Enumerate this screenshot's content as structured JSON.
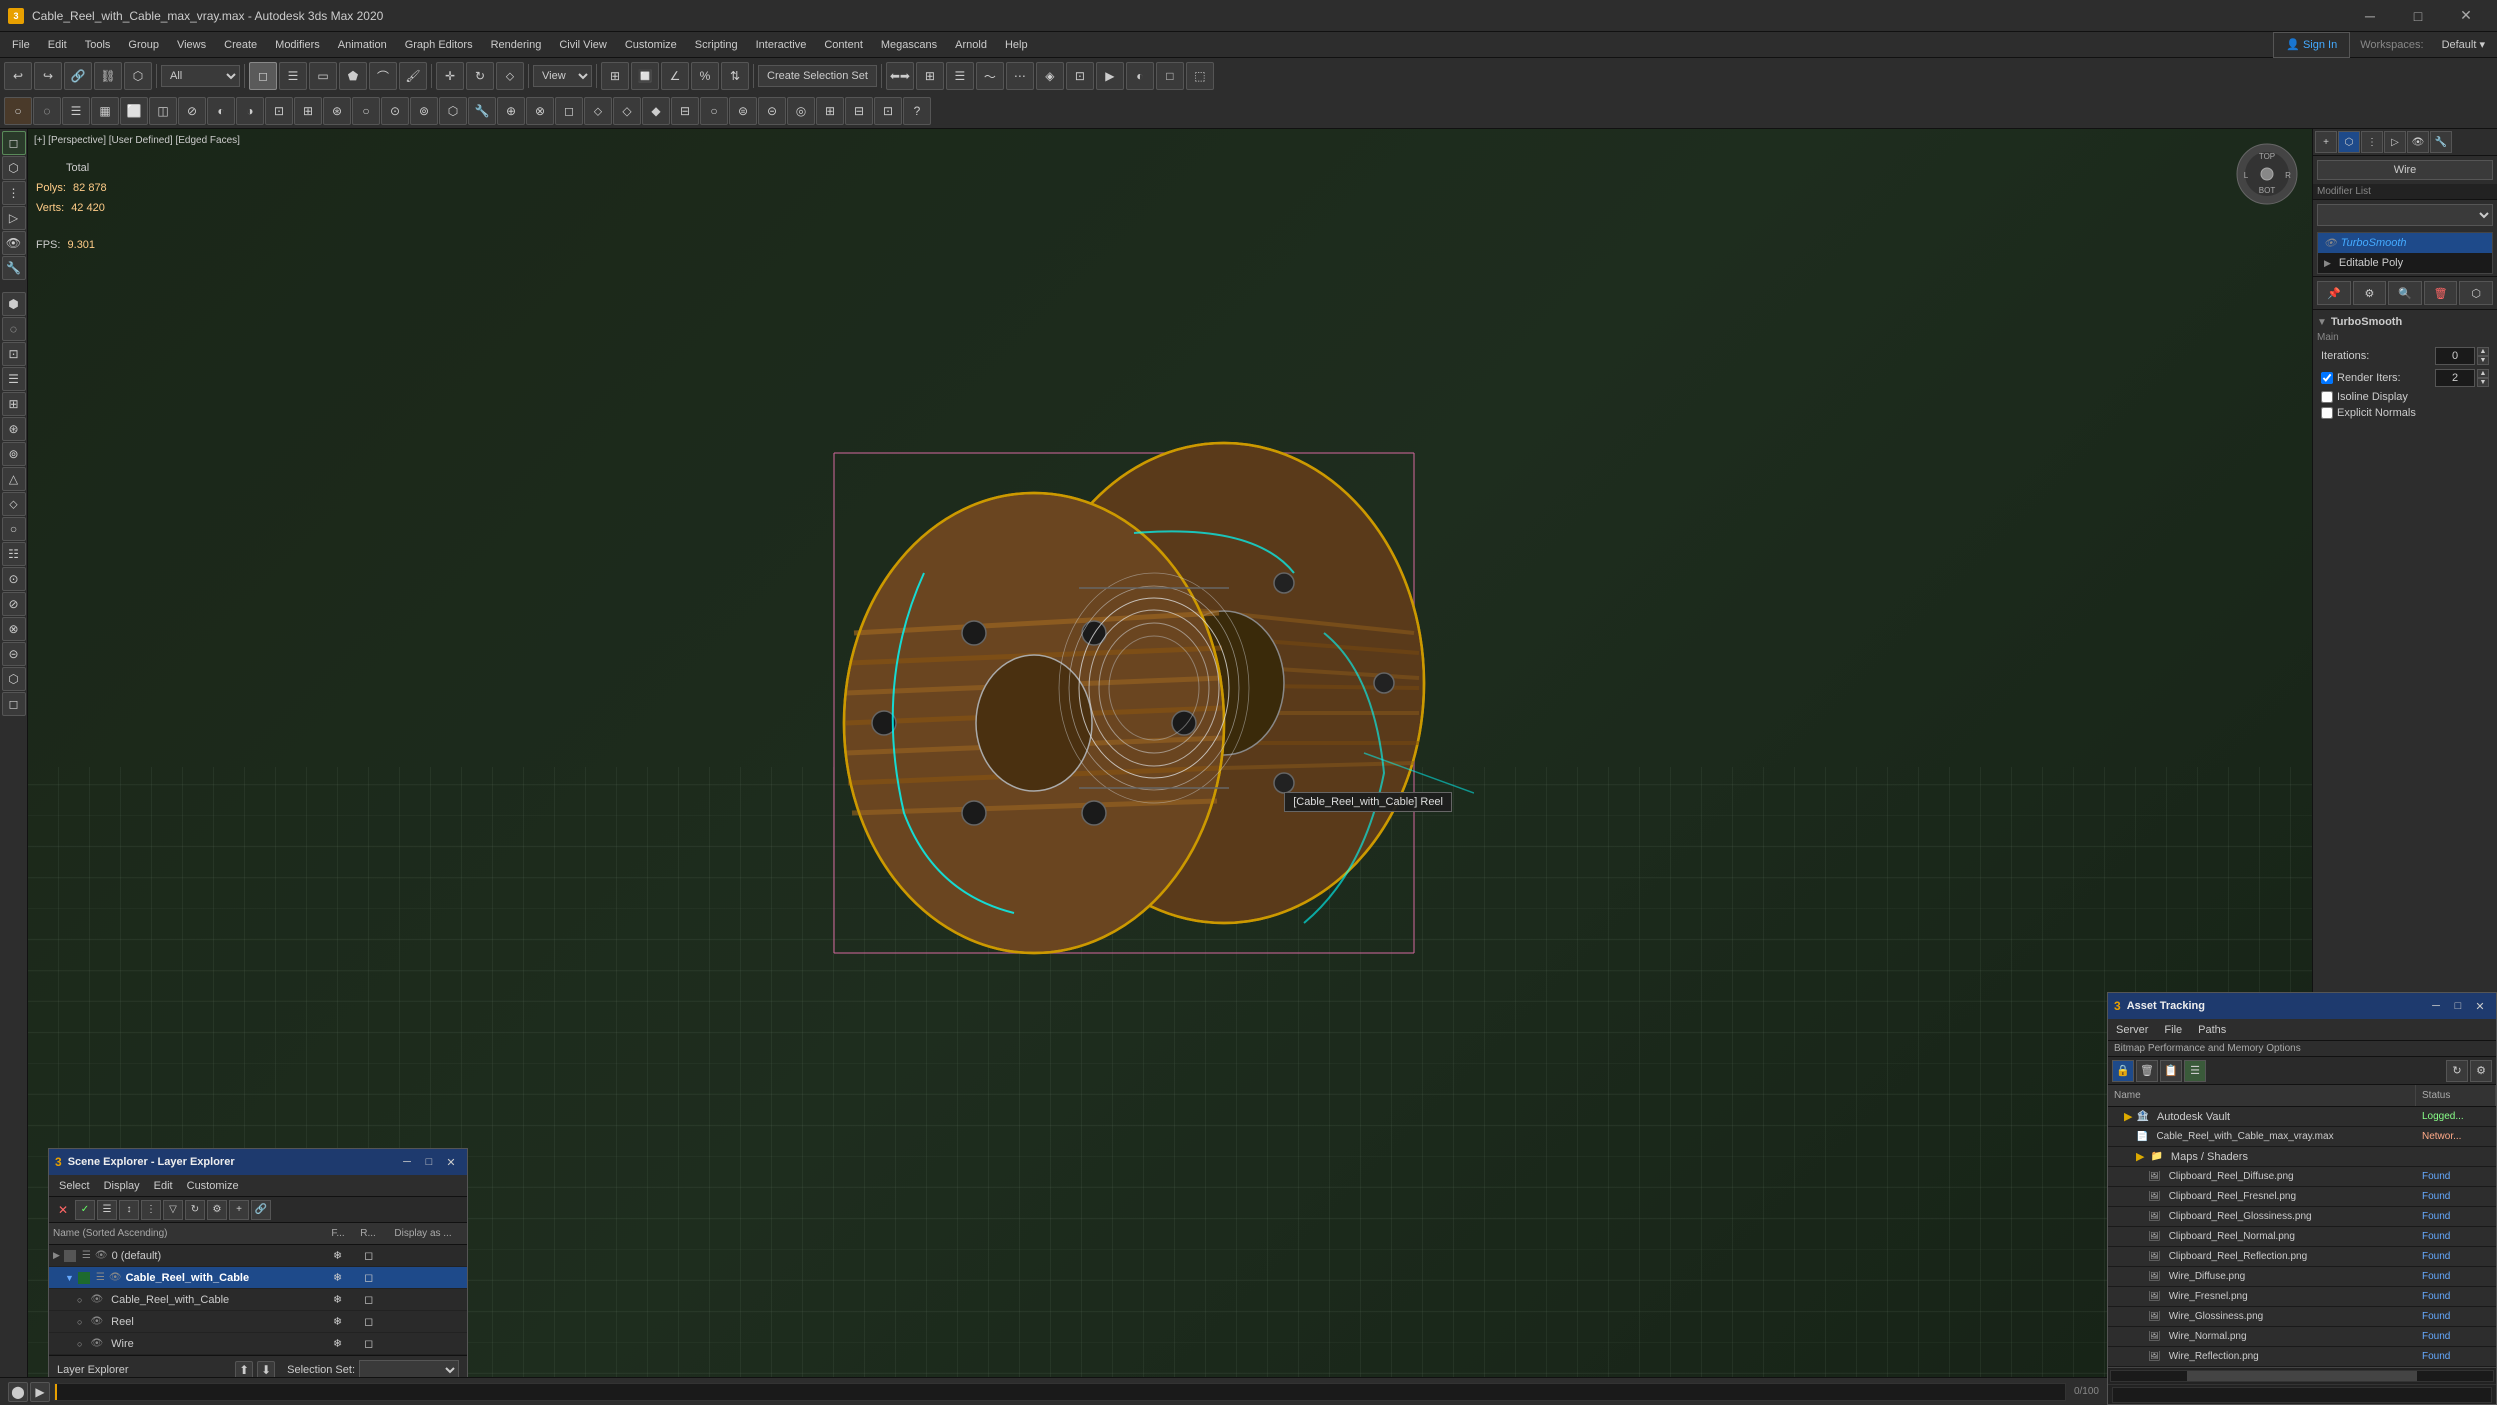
{
  "window": {
    "title": "Cable_Reel_with_Cable_max_vray.max - Autodesk 3ds Max 2020",
    "icon": "3"
  },
  "titlebar": {
    "title": "Cable_Reel_with_Cable_max_vray.max - Autodesk 3ds Max 2020",
    "minimize": "─",
    "maximize": "□",
    "close": "✕"
  },
  "menubar": {
    "items": [
      "File",
      "Edit",
      "Tools",
      "Group",
      "Views",
      "Create",
      "Modifiers",
      "Animation",
      "Graph Editors",
      "Rendering",
      "Civil View",
      "Customize",
      "Scripting",
      "Interactive",
      "Content",
      "Megascans",
      "Arnold",
      "Help"
    ]
  },
  "toolbar": {
    "mode_dropdown": "All",
    "create_selection_set": "Create Selection Set",
    "view_dropdown": "View"
  },
  "viewport": {
    "label": "[+] [Perspective] [User Defined] [Edged Faces]",
    "stats": {
      "total_label": "Total",
      "polys_label": "Polys:",
      "polys_value": "82 878",
      "verts_label": "Verts:",
      "verts_value": "42 420",
      "fps_label": "FPS:",
      "fps_value": "9.301"
    },
    "tooltip": "[Cable_Reel_with_Cable] Reel"
  },
  "right_panel": {
    "wire_label": "Wire",
    "modifier_list_label": "Modifier List",
    "modifiers": [
      {
        "name": "TurboSmooth",
        "active": true
      },
      {
        "name": "Editable Poly",
        "active": false
      }
    ],
    "turbosmooth": {
      "title": "TurboSmooth",
      "main_label": "Main",
      "iterations_label": "Iterations:",
      "iterations_value": "0",
      "render_iters_label": "Render Iters:",
      "render_iters_value": "2",
      "isoline_display_label": "Isoline Display",
      "explicit_normals_label": "Explicit Normals"
    }
  },
  "scene_explorer": {
    "title": "Scene Explorer - Layer Explorer",
    "menus": [
      "Select",
      "Display",
      "Edit",
      "Customize"
    ],
    "columns": {
      "name": "Name (Sorted Ascending)",
      "freeze": "F...",
      "render": "R...",
      "display_as": "Display as ..."
    },
    "rows": [
      {
        "name": "0 (default)",
        "indent": 0,
        "layer": true,
        "color": "#555",
        "selected": false
      },
      {
        "name": "Cable_Reel_with_Cable",
        "indent": 1,
        "layer": true,
        "color": "#1e6a2e",
        "selected": true
      },
      {
        "name": "Cable_Reel_with_Cable",
        "indent": 2,
        "layer": false,
        "color": "",
        "selected": false
      },
      {
        "name": "Reel",
        "indent": 2,
        "layer": false,
        "color": "",
        "selected": false
      },
      {
        "name": "Wire",
        "indent": 2,
        "layer": false,
        "color": "",
        "selected": false
      }
    ],
    "footer": {
      "layer_explorer_label": "Layer Explorer",
      "selection_set_label": "Selection Set:"
    }
  },
  "asset_tracking": {
    "title": "Asset Tracking",
    "menus": [
      "Server",
      "File",
      "Paths"
    ],
    "submenu": "Bitmap Performance and Memory    Options",
    "columns": {
      "name": "Name",
      "status": "Status"
    },
    "tree": [
      {
        "name": "Autodesk Vault",
        "indent": 0,
        "status": "Logged...",
        "type": "folder"
      },
      {
        "name": "Cable_Reel_with_Cable_max_vray.max",
        "indent": 1,
        "status": "Networ...",
        "type": "file"
      },
      {
        "name": "Maps / Shaders",
        "indent": 2,
        "status": "",
        "type": "folder"
      },
      {
        "name": "Clipboard_Reel_Diffuse.png",
        "indent": 3,
        "status": "Found",
        "type": "file"
      },
      {
        "name": "Clipboard_Reel_Fresnel.png",
        "indent": 3,
        "status": "Found",
        "type": "file"
      },
      {
        "name": "Clipboard_Reel_Glossiness.png",
        "indent": 3,
        "status": "Found",
        "type": "file"
      },
      {
        "name": "Clipboard_Reel_Normal.png",
        "indent": 3,
        "status": "Found",
        "type": "file"
      },
      {
        "name": "Clipboard_Reel_Reflection.png",
        "indent": 3,
        "status": "Found",
        "type": "file"
      },
      {
        "name": "Wire_Diffuse.png",
        "indent": 3,
        "status": "Found",
        "type": "file"
      },
      {
        "name": "Wire_Fresnel.png",
        "indent": 3,
        "status": "Found",
        "type": "file"
      },
      {
        "name": "Wire_Glossiness.png",
        "indent": 3,
        "status": "Found",
        "type": "file"
      },
      {
        "name": "Wire_Normal.png",
        "indent": 3,
        "status": "Found",
        "type": "file"
      },
      {
        "name": "Wire_Reflection.png",
        "indent": 3,
        "status": "Found",
        "type": "file"
      }
    ]
  }
}
